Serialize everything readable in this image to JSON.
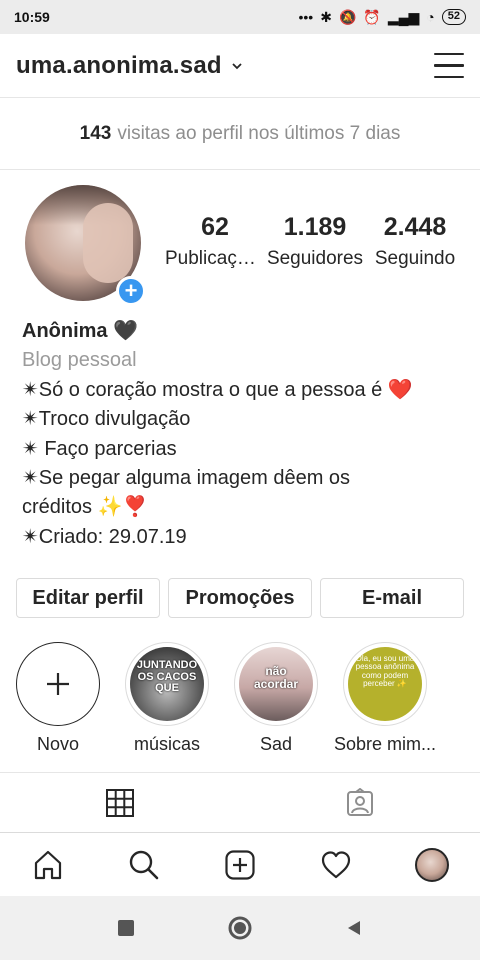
{
  "status_bar": {
    "time": "10:59",
    "battery": "52"
  },
  "header": {
    "username": "uma.anonima.sad"
  },
  "visits": {
    "count": "143",
    "text": "visitas ao perfil nos últimos 7 dias"
  },
  "stats": [
    {
      "number": "62",
      "label": "Publicações"
    },
    {
      "number": "1.189",
      "label": "Seguidores"
    },
    {
      "number": "2.448",
      "label": "Seguindo"
    }
  ],
  "bio": {
    "name": "Anônima 🖤",
    "category": "Blog pessoal",
    "lines": [
      "✴Só o coração mostra o que a pessoa é ❤️",
      "✴Troco divulgação",
      "✴ Faço parcerias",
      "✴Se pegar alguma imagem dêem os",
      "créditos ✨❣️",
      "✴Criado: 29.07.19"
    ]
  },
  "buttons": {
    "edit": "Editar perfil",
    "promotions": "Promoções",
    "email": "E-mail"
  },
  "highlights": [
    {
      "label": "Novo"
    },
    {
      "label": "músicas",
      "cover_text": "JUNTANDO OS CACOS QUE"
    },
    {
      "label": "Sad",
      "cover_text": "não acordar"
    },
    {
      "label": "Sobre mim...",
      "cover_text": "Ola, eu sou uma pessoa anônima como podem perceber ✨"
    }
  ],
  "colors": {
    "accent": "#3897f0",
    "text": "#262626",
    "muted": "#8e8e8e",
    "border": "#dbdbdb"
  },
  "icons": {
    "tabs": [
      "grid-icon",
      "tagged-person-icon"
    ],
    "bottom_nav": [
      "home-icon",
      "search-icon",
      "add-post-icon",
      "heart-icon",
      "profile-avatar"
    ],
    "system_nav": [
      "recents-square-icon",
      "home-circle-icon",
      "back-triangle-icon"
    ]
  }
}
